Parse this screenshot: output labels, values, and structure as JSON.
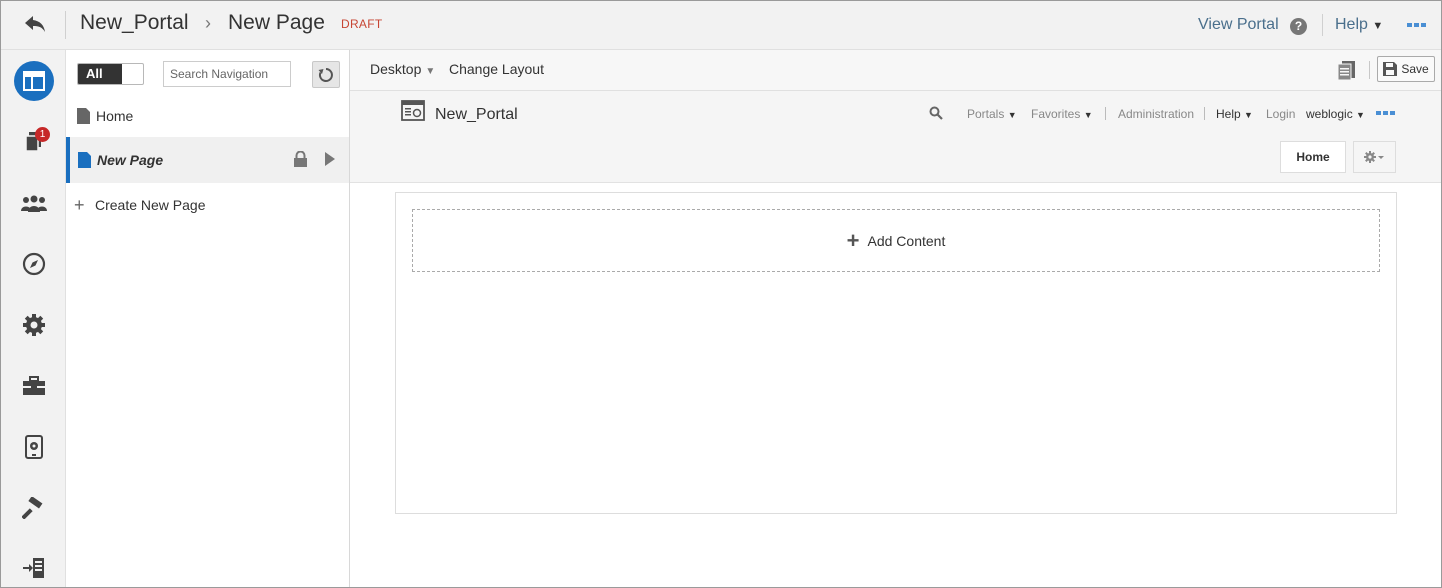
{
  "header": {
    "breadcrumb_portal": "New_Portal",
    "breadcrumb_separator": "›",
    "breadcrumb_page": "New Page",
    "status_badge": "DRAFT",
    "view_portal": "View Portal",
    "help_icon_glyph": "?",
    "help_menu": "Help"
  },
  "rail": {
    "notification_count": "1",
    "icons": [
      "pages-icon",
      "assets-icon",
      "members-icon",
      "compass-icon",
      "settings-icon",
      "toolbox-icon",
      "device-settings-icon",
      "build-icon",
      "export-icon"
    ],
    "accent_color": "#1a6fbf"
  },
  "navigation": {
    "toggle_label": "All",
    "search_placeholder": "Search Navigation",
    "items": [
      {
        "label": "Home",
        "selected": false
      },
      {
        "label": "New Page",
        "selected": true,
        "locked": true
      }
    ],
    "create_label": "Create New Page"
  },
  "toolbar": {
    "device_label": "Desktop",
    "change_layout_label": "Change Layout",
    "save_label": "Save"
  },
  "portal_preview": {
    "title": "New_Portal",
    "links": {
      "portals": "Portals",
      "favorites": "Favorites",
      "administration": "Administration",
      "help": "Help",
      "login": "Login",
      "user": "weblogic"
    },
    "home_tab": "Home"
  },
  "content": {
    "add_content_label": "Add Content"
  }
}
